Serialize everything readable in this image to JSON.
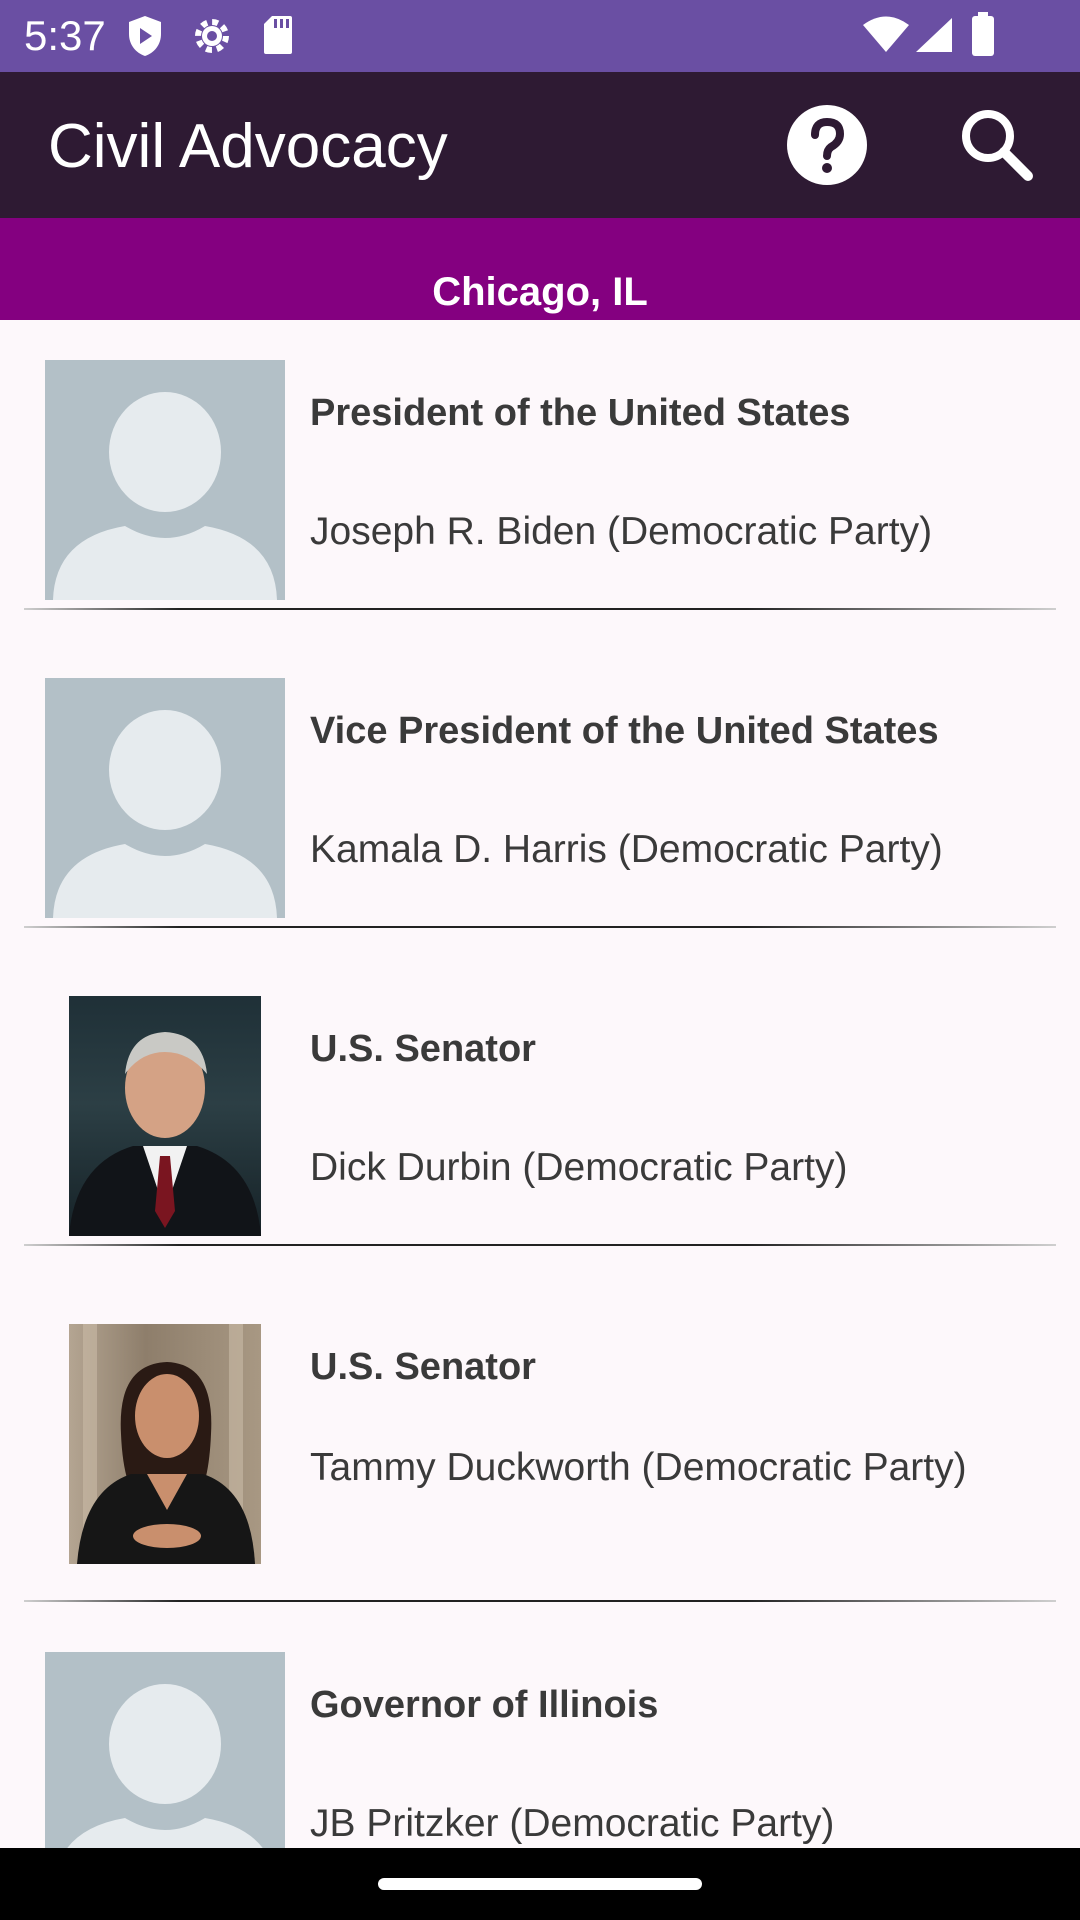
{
  "status_bar": {
    "time": "5:37",
    "icons": [
      "shield-icon",
      "gear-icon",
      "sd-card-icon",
      "wifi-icon",
      "signal-icon",
      "battery-icon"
    ]
  },
  "app_bar": {
    "title": "Civil Advocacy",
    "actions": [
      "help-icon",
      "search-icon"
    ]
  },
  "location": "Chicago, IL",
  "officials": [
    {
      "office": "President of the United States",
      "person": "Joseph R. Biden (Democratic Party)",
      "photo": "placeholder"
    },
    {
      "office": "Vice President of the United States",
      "person": "Kamala D. Harris (Democratic Party)",
      "photo": "placeholder"
    },
    {
      "office": "U.S. Senator",
      "person": "Dick Durbin (Democratic Party)",
      "photo": "portrait-man"
    },
    {
      "office": "U.S. Senator",
      "person": "Tammy Duckworth (Democratic Party)",
      "photo": "portrait-woman"
    },
    {
      "office": "Governor of Illinois",
      "person": "JB Pritzker (Democratic Party)",
      "photo": "placeholder"
    }
  ],
  "colors": {
    "status_bar": "#6a4fa3",
    "app_bar": "#2e1a33",
    "location_banner": "#840080",
    "list_background": "#fdf8fb",
    "placeholder_bg": "#b3c0c7",
    "placeholder_silhouette": "#e6ebee"
  }
}
